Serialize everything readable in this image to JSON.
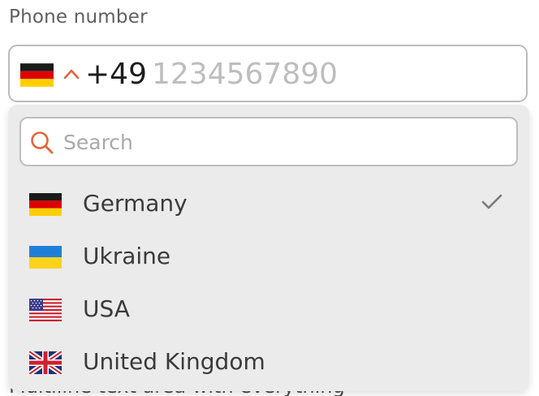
{
  "phone_field": {
    "label": "Phone number",
    "selected_country_flag": "germany-flag",
    "dial_code": "+49",
    "placeholder": "1234567890",
    "value": ""
  },
  "dropdown": {
    "search": {
      "placeholder": "Search",
      "value": ""
    },
    "countries": [
      {
        "name": "Germany",
        "flag": "germany-flag",
        "selected": true
      },
      {
        "name": "Ukraine",
        "flag": "ukraine-flag",
        "selected": false
      },
      {
        "name": "USA",
        "flag": "usa-flag",
        "selected": false
      },
      {
        "name": "United Kingdom",
        "flag": "uk-flag",
        "selected": false
      }
    ]
  },
  "behind_label": "Multiline text area with everything",
  "colors": {
    "accent": "#e2663b",
    "check": "#7a7a7a",
    "dropdown_bg": "#ebebeb",
    "border": "#bcbcbc"
  }
}
